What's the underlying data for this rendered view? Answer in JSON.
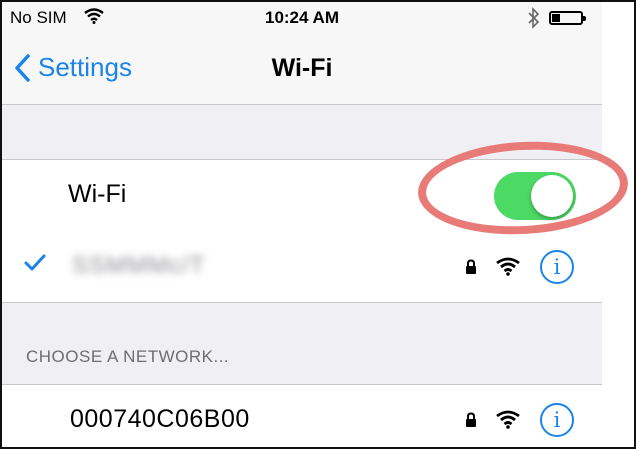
{
  "status_bar": {
    "carrier": "No SIM",
    "time": "10:24 AM",
    "battery_level": 0.3,
    "icons": [
      "wifi-icon",
      "bluetooth-icon",
      "battery-icon"
    ]
  },
  "nav": {
    "back_label": "Settings",
    "title": "Wi-Fi"
  },
  "wifi_toggle": {
    "label": "Wi-Fi",
    "on": true,
    "color": "#4cd964"
  },
  "connected_network": {
    "name": "SSMMMc/T",
    "blurred": true,
    "secured": true
  },
  "section": {
    "header": "CHOOSE A NETWORK..."
  },
  "networks": [
    {
      "name": "000740C06B00",
      "secured": true
    }
  ],
  "colors": {
    "accent": "#1a84e8",
    "highlight_ring": "#e87a78"
  }
}
